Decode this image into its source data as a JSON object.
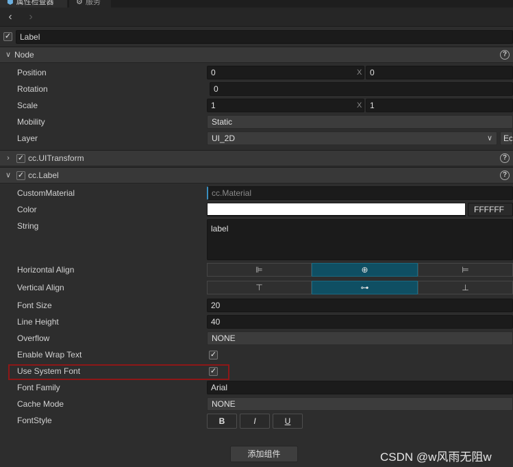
{
  "tabs": [
    {
      "label": "属性检查器",
      "icon": "inspector-icon"
    },
    {
      "label": "服务",
      "icon": "service-icon"
    }
  ],
  "node_name": "Label",
  "node_section": {
    "title": "Node",
    "position": {
      "x": "0",
      "y": "0",
      "x_axis": "X"
    },
    "rotation": "0",
    "scale": {
      "x": "1",
      "y": "1",
      "x_axis": "X"
    },
    "mobility": "Static",
    "layer": "UI_2D",
    "layer_edit": "Ec",
    "labels": {
      "position": "Position",
      "rotation": "Rotation",
      "scale": "Scale",
      "mobility": "Mobility",
      "layer": "Layer"
    }
  },
  "transform_section": {
    "title": "cc.UITransform"
  },
  "label_section": {
    "title": "cc.Label",
    "labels": {
      "custom_material": "CustomMaterial",
      "color": "Color",
      "string": "String",
      "h_align": "Horizontal Align",
      "v_align": "Vertical Align",
      "font_size": "Font Size",
      "line_height": "Line Height",
      "overflow": "Overflow",
      "wrap": "Enable Wrap Text",
      "system_font": "Use System Font",
      "font_family": "Font Family",
      "cache_mode": "Cache Mode",
      "font_style": "FontStyle"
    },
    "custom_material_placeholder": "cc.Material",
    "color_hex": "FFFFFF",
    "color_value": "#ffffff",
    "string": "label",
    "font_size": "20",
    "line_height": "40",
    "overflow": "NONE",
    "enable_wrap_text": true,
    "use_system_font": true,
    "font_family": "Arial",
    "cache_mode": "NONE",
    "font_style": {
      "bold": "B",
      "italic": "I",
      "underline": "U"
    },
    "h_align_selected": "center",
    "v_align_selected": "center"
  },
  "add_component": "添加组件",
  "watermark": "CSDN @w风雨无阻w",
  "colors": {
    "accent": "#0f4f63",
    "highlight": "#8f1717"
  }
}
